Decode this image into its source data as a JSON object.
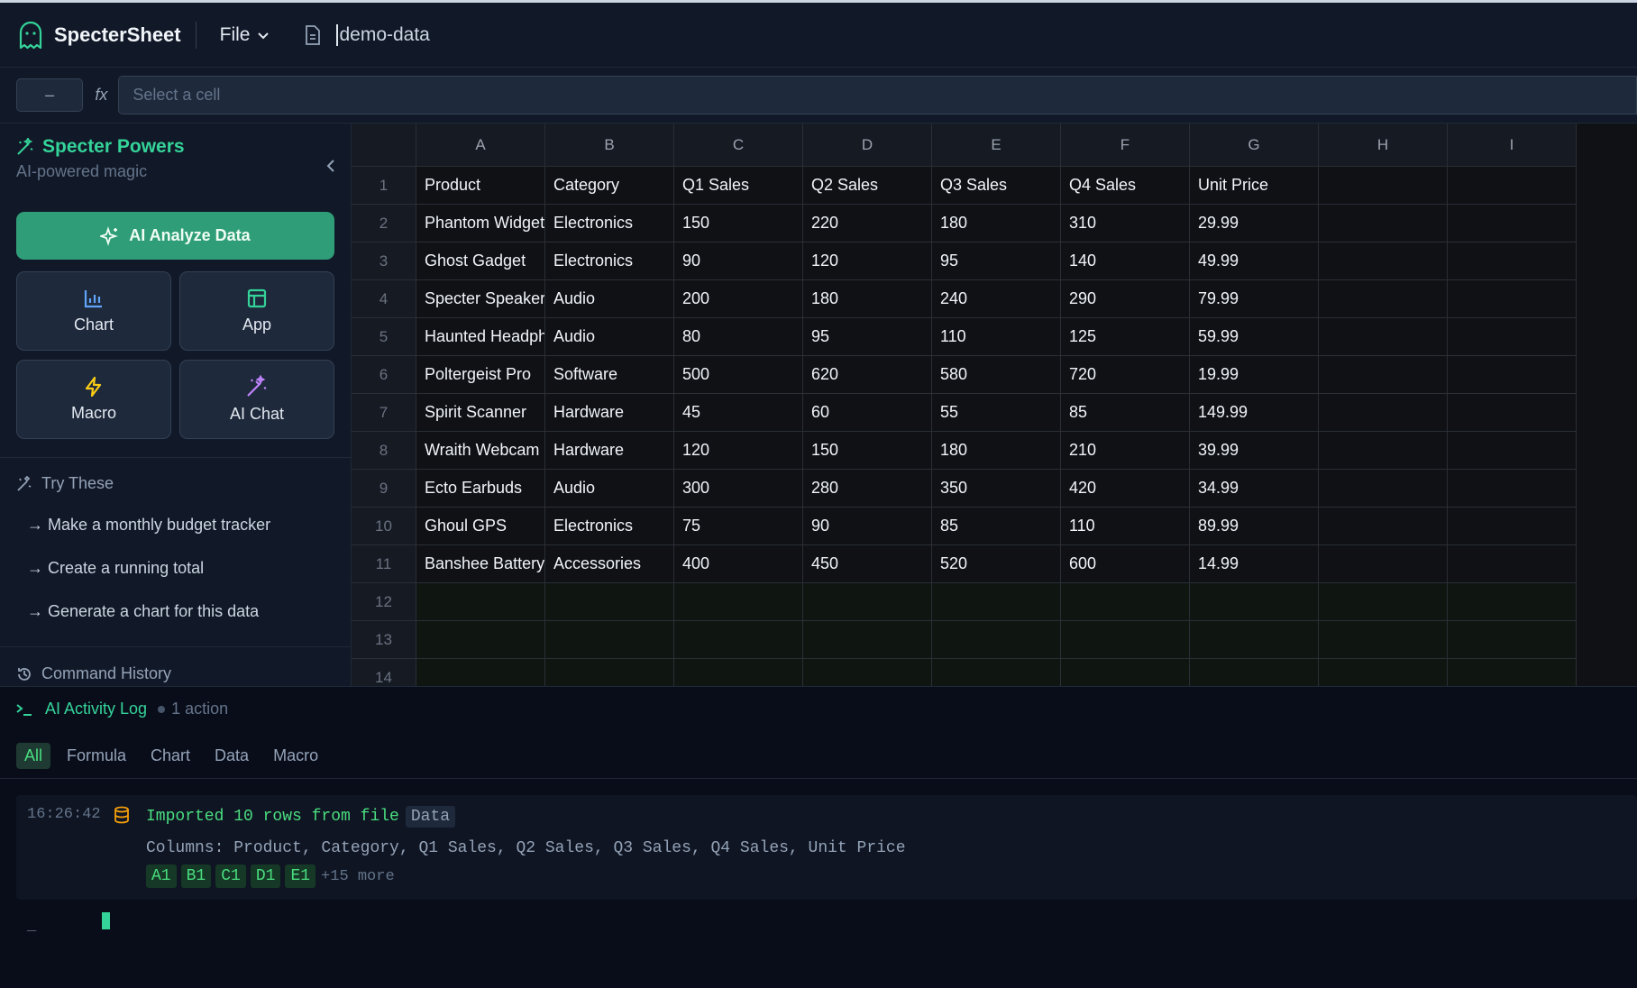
{
  "app": {
    "name": "SpecterSheet",
    "file_menu": "File",
    "document_name": "demo-data"
  },
  "formula_bar": {
    "cell_ref": "–",
    "fx_label": "fx",
    "placeholder": "Select a cell",
    "value": ""
  },
  "sidebar": {
    "title": "Specter Powers",
    "subtitle": "AI-powered magic",
    "analyze_label": "AI Analyze Data",
    "tools": [
      {
        "label": "Chart",
        "icon": "bar-chart-icon",
        "color": "#60a5fa"
      },
      {
        "label": "App",
        "icon": "layout-icon",
        "color": "#34d399"
      },
      {
        "label": "Macro",
        "icon": "lightning-icon",
        "color": "#facc15"
      },
      {
        "label": "AI Chat",
        "icon": "magic-wand-icon",
        "color": "#c084fc"
      }
    ],
    "try_title": "Try These",
    "suggestions": [
      "→ Make a monthly budget tracker",
      "→ Create a running total",
      "→ Generate a chart for this data"
    ],
    "history_title": "Command History"
  },
  "sheet": {
    "columns": [
      "A",
      "B",
      "C",
      "D",
      "E",
      "F",
      "G",
      "H",
      "I"
    ],
    "rows": [
      [
        "Product",
        "Category",
        "Q1 Sales",
        "Q2 Sales",
        "Q3 Sales",
        "Q4 Sales",
        "Unit Price",
        "",
        ""
      ],
      [
        "Phantom Widget",
        "Electronics",
        "150",
        "220",
        "180",
        "310",
        "29.99",
        "",
        ""
      ],
      [
        "Ghost Gadget",
        "Electronics",
        "90",
        "120",
        "95",
        "140",
        "49.99",
        "",
        ""
      ],
      [
        "Specter Speaker",
        "Audio",
        "200",
        "180",
        "240",
        "290",
        "79.99",
        "",
        ""
      ],
      [
        "Haunted Headphones",
        "Audio",
        "80",
        "95",
        "110",
        "125",
        "59.99",
        "",
        ""
      ],
      [
        "Poltergeist Pro",
        "Software",
        "500",
        "620",
        "580",
        "720",
        "19.99",
        "",
        ""
      ],
      [
        "Spirit Scanner",
        "Hardware",
        "45",
        "60",
        "55",
        "85",
        "149.99",
        "",
        ""
      ],
      [
        "Wraith Webcam",
        "Hardware",
        "120",
        "150",
        "180",
        "210",
        "39.99",
        "",
        ""
      ],
      [
        "Ecto Earbuds",
        "Audio",
        "300",
        "280",
        "350",
        "420",
        "34.99",
        "",
        ""
      ],
      [
        "Ghoul GPS",
        "Electronics",
        "75",
        "90",
        "85",
        "110",
        "89.99",
        "",
        ""
      ],
      [
        "Banshee Battery",
        "Accessories",
        "400",
        "450",
        "520",
        "600",
        "14.99",
        "",
        ""
      ],
      [
        "",
        "",
        "",
        "",
        "",
        "",
        "",
        "",
        ""
      ],
      [
        "",
        "",
        "",
        "",
        "",
        "",
        "",
        "",
        ""
      ],
      [
        "",
        "",
        "",
        "",
        "",
        "",
        "",
        "",
        ""
      ]
    ]
  },
  "log": {
    "title": "AI Activity Log",
    "count": "1 action",
    "filters": [
      "All",
      "Formula",
      "Chart",
      "Data",
      "Macro"
    ],
    "active_filter": "All",
    "entry": {
      "time": "16:26:42",
      "message": "Imported 10 rows from file",
      "tag": "Data",
      "detail": "Columns: Product, Category, Q1 Sales, Q2 Sales, Q3 Sales, Q4 Sales, Unit Price",
      "cells": [
        "A1",
        "B1",
        "C1",
        "D1",
        "E1"
      ],
      "more": "+15 more"
    },
    "prompt": "_"
  },
  "colors": {
    "accent": "#34d399",
    "button": "#2f9e78"
  }
}
